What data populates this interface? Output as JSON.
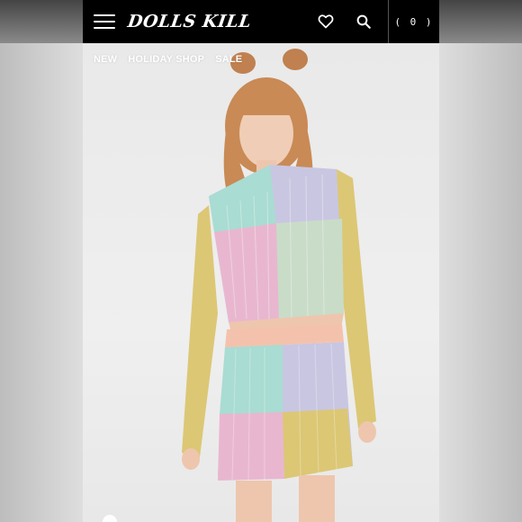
{
  "header": {
    "logo_text": "DOLLS KILL",
    "cart_label": "( 0 )",
    "menu_icon": "hamburger-menu-icon",
    "wishlist_icon": "heart-icon",
    "search_icon": "search-icon"
  },
  "nav": {
    "items": [
      {
        "label": "NEW"
      },
      {
        "label": "HOLIDAY SHOP"
      },
      {
        "label": "SALE"
      }
    ]
  },
  "colors": {
    "header_bg": "#000000",
    "background": "#ececec",
    "pastel_pink": "#e8b7cf",
    "pastel_mint": "#a9dcd2",
    "pastel_lavender": "#c9c6e2",
    "pastel_yellow": "#dcc775",
    "pastel_peach": "#f4c2ac"
  }
}
